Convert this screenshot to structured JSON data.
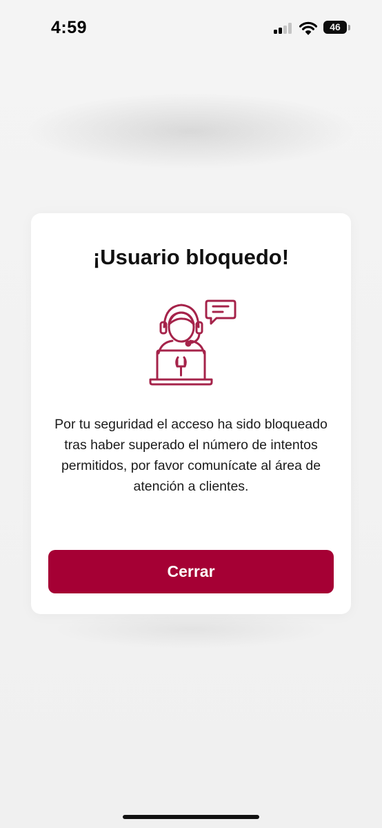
{
  "status_bar": {
    "time": "4:59",
    "battery_level": "46",
    "signal_bars_active": 2,
    "signal_bars_total": 4
  },
  "modal": {
    "title": "¡Usuario bloquedo!",
    "illustration_icon": "customer-support-agent-icon",
    "message": "Por tu seguridad el acceso ha sido bloqueado tras haber superado el número de intentos permitidos, por favor comunícate al área de atención a clientes.",
    "close_label": "Cerrar"
  },
  "colors": {
    "accent": "#a50034",
    "icon": "#a5234a",
    "card": "#ffffff",
    "backdrop": "#f1f1f1"
  }
}
